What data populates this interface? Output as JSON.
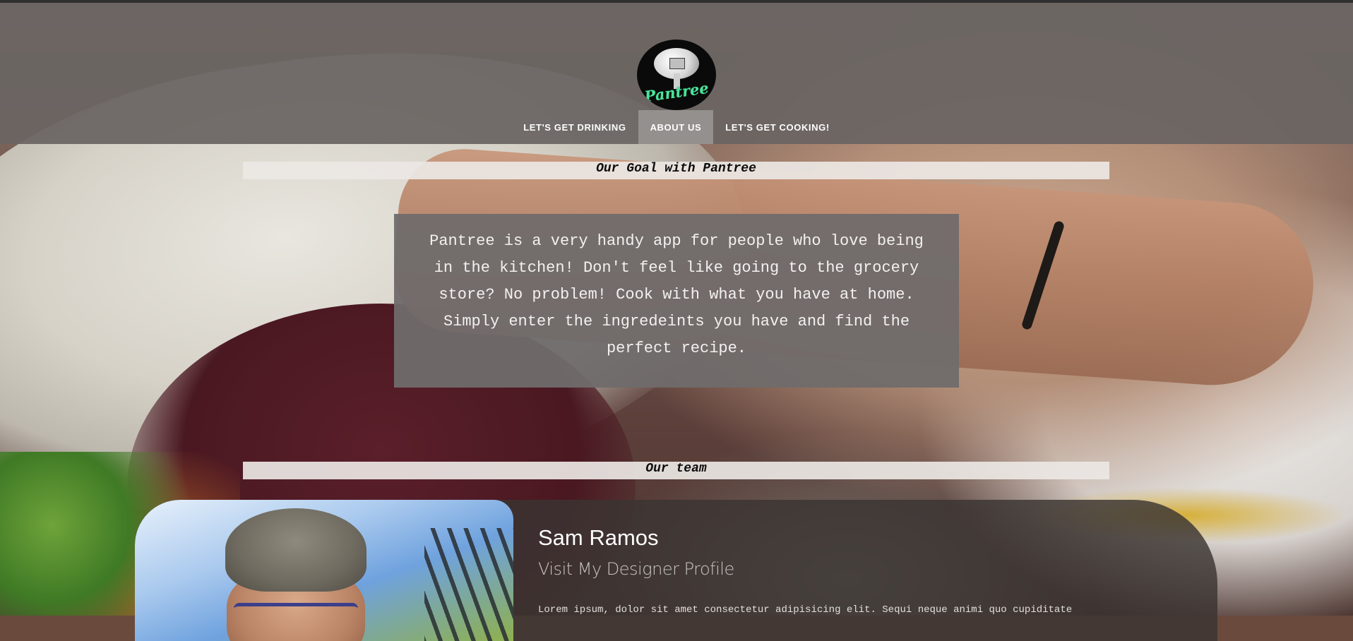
{
  "brand": {
    "logo_text": "Pantree"
  },
  "nav": {
    "items": [
      {
        "label": "LET'S GET DRINKING",
        "active": false
      },
      {
        "label": "ABOUT US",
        "active": true
      },
      {
        "label": "LET'S GET COOKING!",
        "active": false
      }
    ]
  },
  "goal": {
    "heading": "Our Goal with Pantree",
    "body": "Pantree is a very handy app for people who love being in the kitchen! Don't feel like going to the grocery store? No problem! Cook with what you have at home. Simply enter the ingredeints you have and find the perfect recipe."
  },
  "team": {
    "heading": "Our team",
    "members": [
      {
        "name": "Sam Ramos",
        "profile_link": "Visit My Designer Profile",
        "bio": "Lorem ipsum, dolor sit amet consectetur adipisicing elit. Sequi neque animi quo cupiditate"
      }
    ]
  },
  "colors": {
    "header_bg": "#69645f",
    "nav_active_bg": "#96928f",
    "logo_text": "#4be39b",
    "heading_bar": "#ece7e4"
  }
}
